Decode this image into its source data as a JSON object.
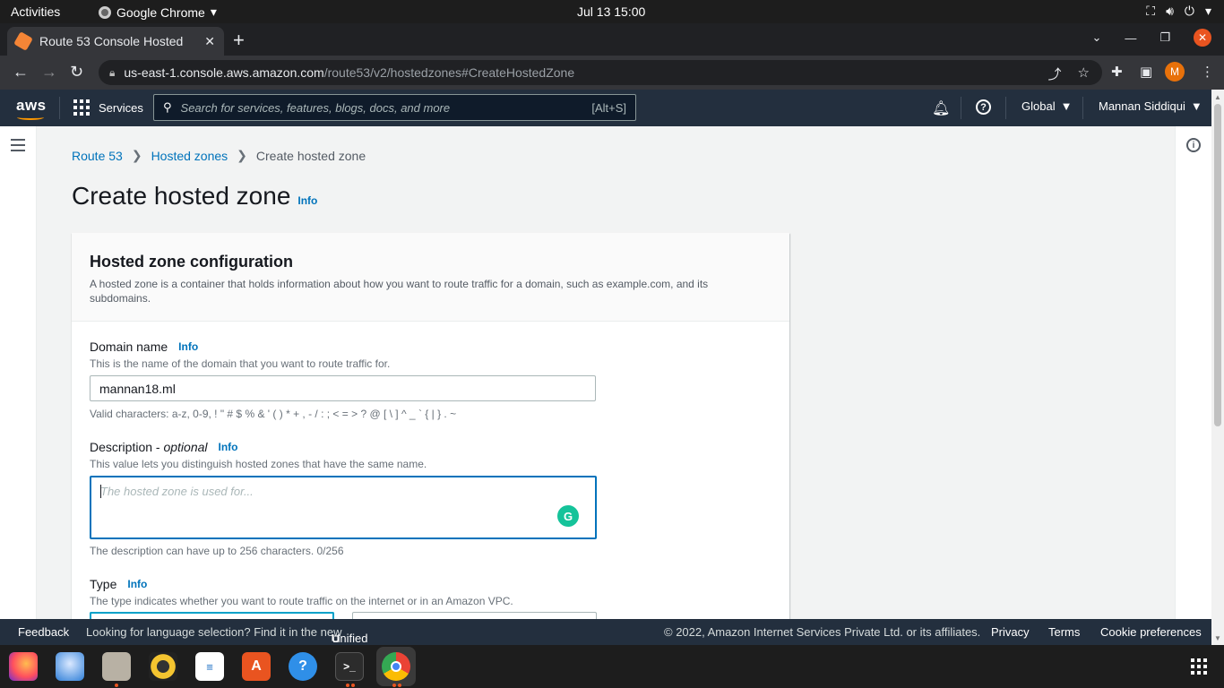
{
  "os": {
    "activities": "Activities",
    "app_name": "Google Chrome",
    "clock": "Jul 13  15:00"
  },
  "browser": {
    "tab_title": "Route 53 Console Hosted",
    "url_host": "us-east-1.console.aws.amazon.com",
    "url_path": "/route53/v2/hostedzones#CreateHostedZone",
    "profile_initial": "M"
  },
  "aws_nav": {
    "logo": "aws",
    "services": "Services",
    "search_placeholder": "Search for services, features, blogs, docs, and more",
    "search_shortcut": "[Alt+S]",
    "region": "Global",
    "user": "Mannan Siddiqui"
  },
  "breadcrumb": {
    "items": [
      "Route 53",
      "Hosted zones"
    ],
    "current": "Create hosted zone"
  },
  "page": {
    "title": "Create hosted zone",
    "info": "Info"
  },
  "panel": {
    "title": "Hosted zone configuration",
    "description": "A hosted zone is a container that holds information about how you want to route traffic for a domain, such as example.com, and its subdomains."
  },
  "domain": {
    "label": "Domain name",
    "info": "Info",
    "hint": "This is the name of the domain that you want to route traffic for.",
    "value": "mannan18.ml",
    "valid_chars": "Valid characters: a-z, 0-9, ! \" # $ % & ' ( ) * + , - / : ; < = > ? @ [ \\ ] ^ _ ` { | } . ~"
  },
  "description_field": {
    "label": "Description - ",
    "optional": "optional",
    "info": "Info",
    "hint": "This value lets you distinguish hosted zones that have the same name.",
    "placeholder": "The hosted zone is used for...",
    "counter": "The description can have up to 256 characters. 0/256"
  },
  "type_field": {
    "label": "Type",
    "info": "Info",
    "hint": "The type indicates whether you want to route traffic on the internet or in an Amazon VPC."
  },
  "footer": {
    "feedback": "Feedback",
    "language_prompt": "Looking for language selection? Find it in the new",
    "unified_settings": "Unified Settings",
    "copyright": "© 2022, Amazon Internet Services Private Ltd. or its affiliates.",
    "privacy": "Privacy",
    "terms": "Terms",
    "cookies": "Cookie preferences"
  },
  "colors": {
    "aws_nav": "#232f3e",
    "link": "#0073bb",
    "aws_orange": "#ff9900",
    "ubuntu_accent": "#e95420"
  },
  "dock_icons": [
    "firefox-icon",
    "thunderbird-icon",
    "files-icon",
    "rhythmbox-icon",
    "writer-icon",
    "software-icon",
    "help-icon",
    "terminal-icon",
    "chrome-icon"
  ]
}
